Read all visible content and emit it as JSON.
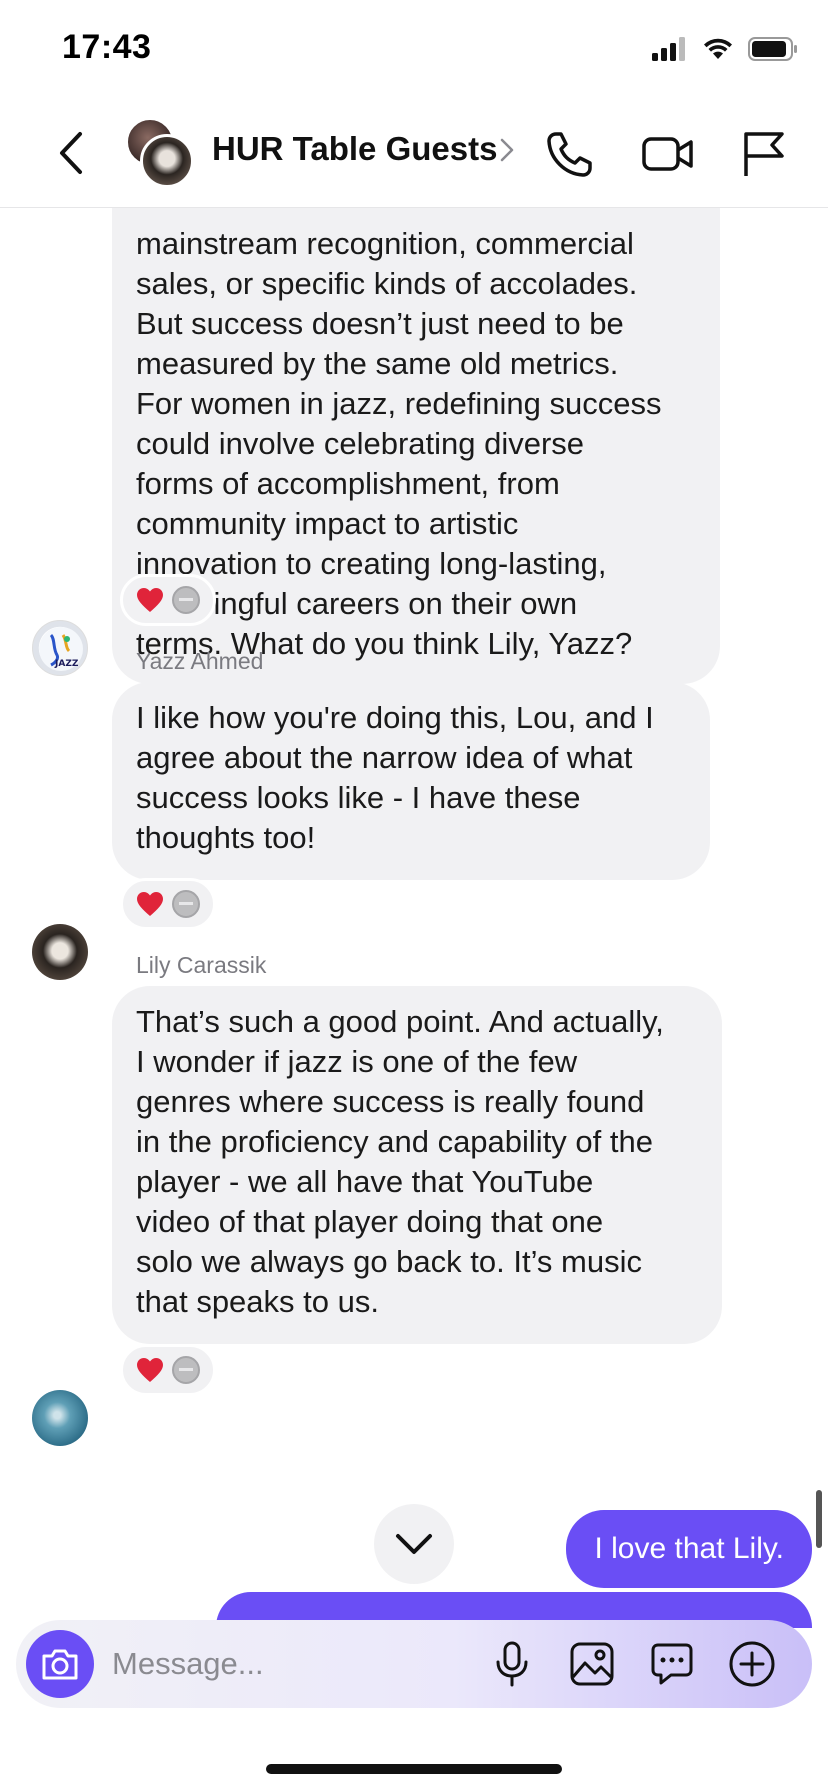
{
  "status_bar": {
    "time": "17:43"
  },
  "header": {
    "title": "HUR Table Guests"
  },
  "messages": [
    {
      "lines": [
        "mainstream recognition, commercial",
        "sales, or specific kinds of accolades.",
        "But success doesn’t just need to be",
        "measured by the same old metrics.",
        "For women in jazz, redefining success",
        "could involve celebrating diverse",
        "forms of accomplishment, from",
        "community impact to artistic",
        "innovation to creating long-lasting,",
        "meaningful careers on their own",
        "terms. What do you think Lily, Yazz?"
      ]
    },
    {
      "sender": "Yazz Ahmed",
      "lines": [
        "I like how you're doing this, Lou, and I",
        "agree about the narrow idea of what",
        "success looks like - I have these",
        "thoughts too!"
      ]
    },
    {
      "sender": "Lily Carassik",
      "lines": [
        "That’s such a good point. And actually,",
        "I wonder if jazz is one of the few",
        "genres where success is really found",
        "in the proficiency and capability of the",
        "player - we all have that YouTube",
        "video of that player doing that one",
        "solo we always go back to. It’s music",
        "that speaks to us."
      ]
    }
  ],
  "outgoing": [
    {
      "text": "I love that Lily."
    }
  ],
  "composer": {
    "placeholder": "Message..."
  },
  "colors": {
    "accent": "#6a4ef5",
    "incoming_bubble": "#f1f1f3",
    "heart": "#e0243a"
  }
}
